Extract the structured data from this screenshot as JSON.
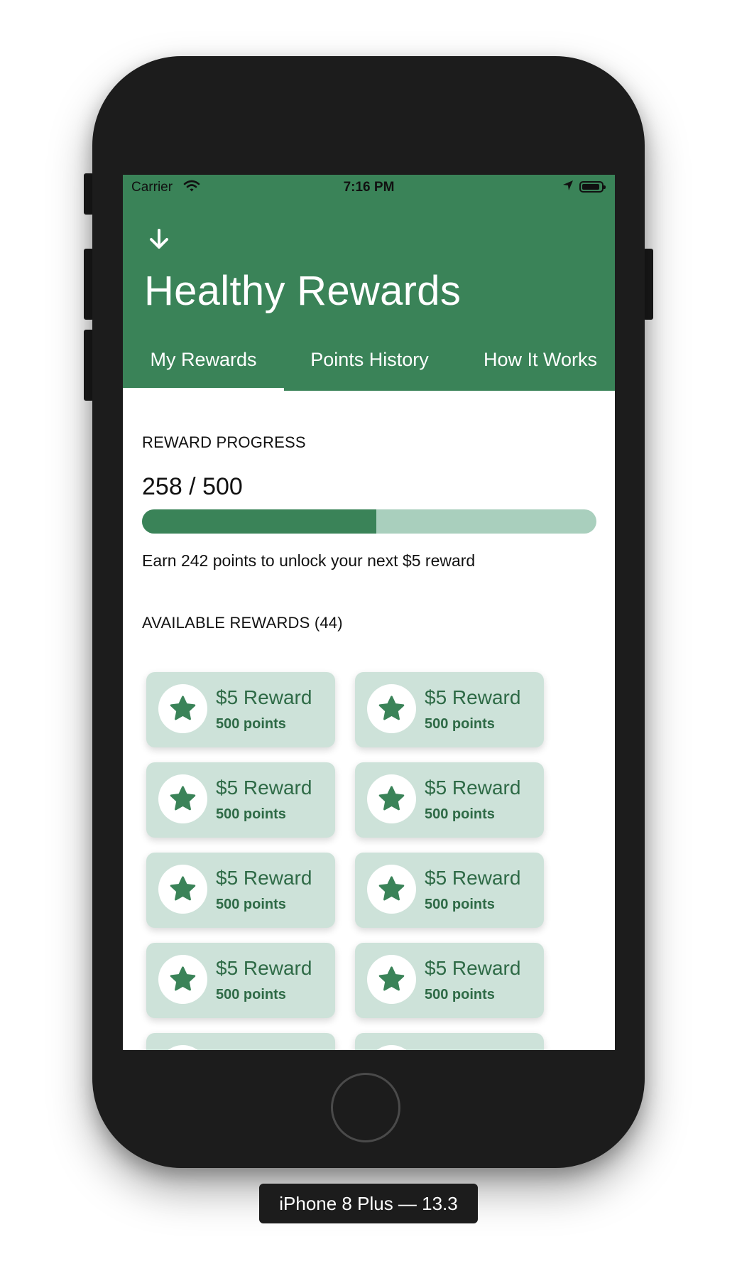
{
  "status_bar": {
    "carrier": "Carrier",
    "time": "7:16 PM"
  },
  "header": {
    "title": "Healthy Rewards"
  },
  "tabs": [
    {
      "label": "My Rewards",
      "active": true
    },
    {
      "label": "Points History",
      "active": false
    },
    {
      "label": "How It Works",
      "active": false
    }
  ],
  "progress": {
    "section_label": "REWARD PROGRESS",
    "value_text": "258 / 500",
    "current": 258,
    "goal": 500,
    "hint": "Earn 242 points to unlock your next $5 reward"
  },
  "rewards": {
    "section_label": "AVAILABLE REWARDS (44)",
    "items": [
      {
        "title": "$5 Reward",
        "points": "500 points"
      },
      {
        "title": "$5 Reward",
        "points": "500 points"
      },
      {
        "title": "$5 Reward",
        "points": "500 points"
      },
      {
        "title": "$5 Reward",
        "points": "500 points"
      },
      {
        "title": "$5 Reward",
        "points": "500 points"
      },
      {
        "title": "$5 Reward",
        "points": "500 points"
      },
      {
        "title": "$5 Reward",
        "points": "500 points"
      },
      {
        "title": "$5 Reward",
        "points": "500 points"
      }
    ]
  },
  "device_caption": "iPhone 8 Plus — 13.3",
  "colors": {
    "brand_green": "#3a8358",
    "track_green": "#a9cfbd",
    "card_bg": "#cde2d9"
  }
}
